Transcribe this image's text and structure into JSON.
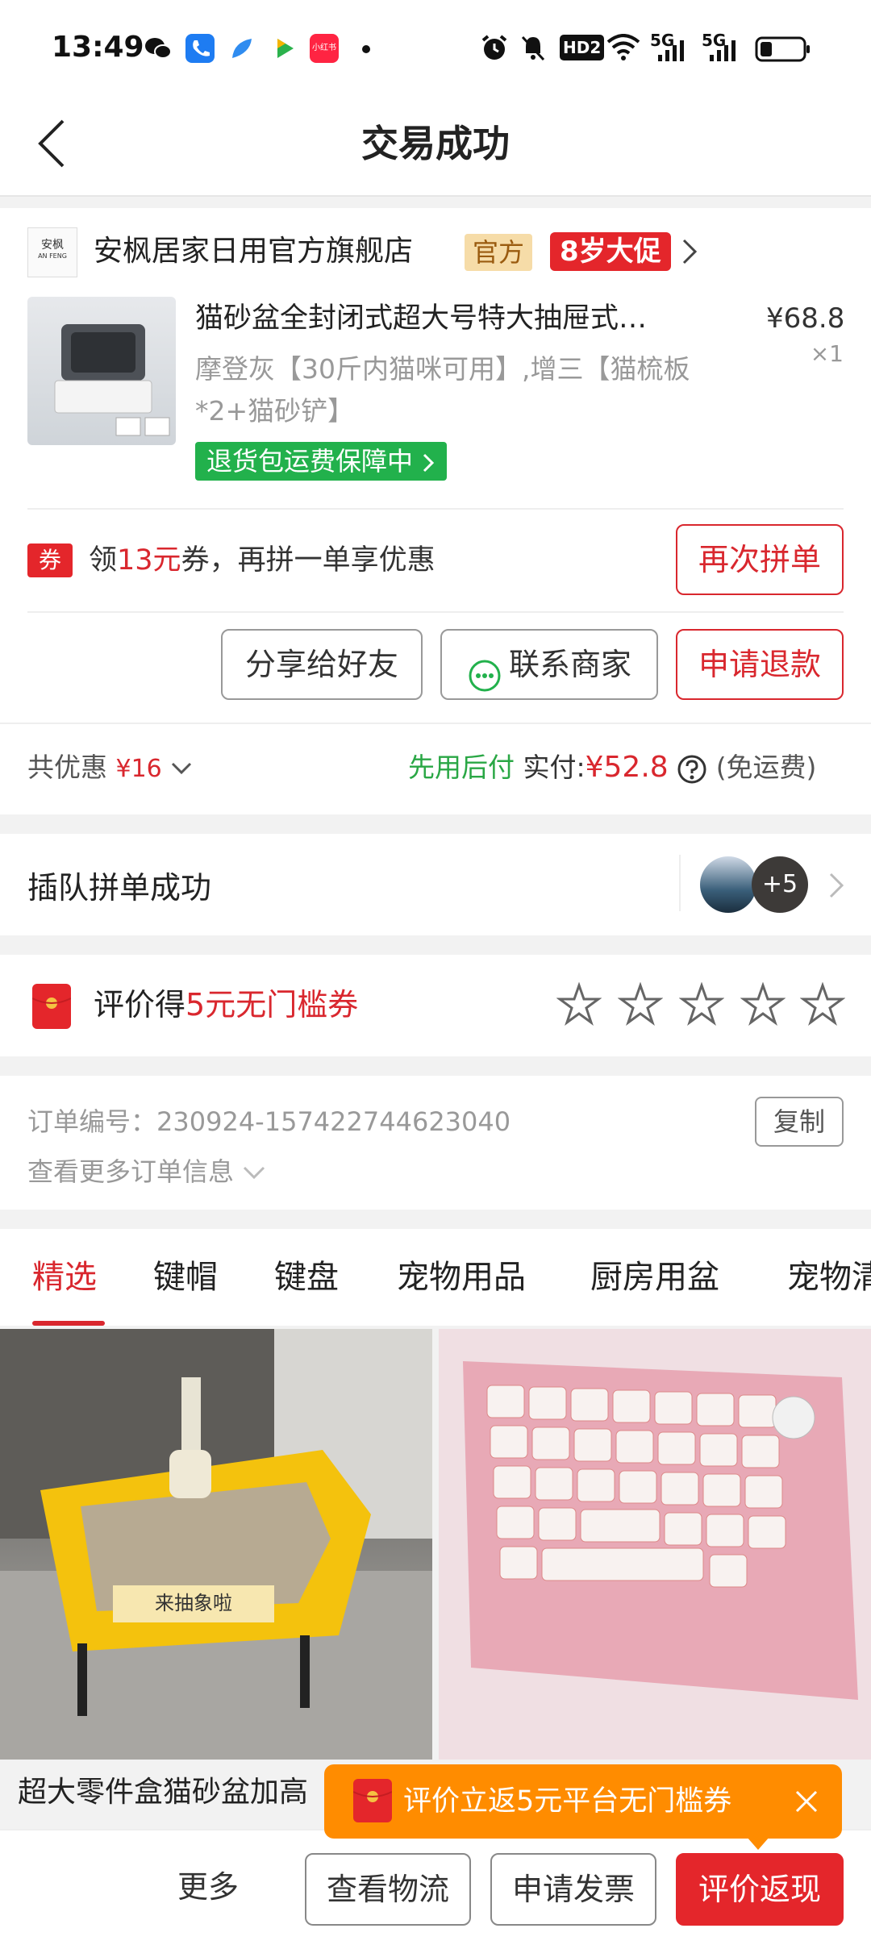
{
  "status_bar": {
    "time": "13:49",
    "app_icons": [
      "wechat-icon",
      "phone-icon",
      "feather-icon",
      "video-icon",
      "xiaohongshu-icon"
    ],
    "xhs_label": "小红书",
    "hd_label": "HD2",
    "net1": "5G",
    "net2": "5G"
  },
  "nav": {
    "title": "交易成功"
  },
  "shop": {
    "logo_text": "安枫",
    "logo_sub": "AN FENG",
    "name": "安枫居家日用官方旗舰店",
    "badge_official": "官方",
    "badge_promo": "8岁大促"
  },
  "product": {
    "title": "猫砂盆全封闭式超大号特大抽屉式…",
    "price": "¥68.8",
    "qty": "×1",
    "spec": "摩登灰【30斤内猫咪可用】,增三【猫梳板*2+猫砂铲】",
    "guarantee": "退货包运费保障中"
  },
  "coupon": {
    "icon": "券",
    "text_prefix": "领",
    "amount": "13元",
    "text_suffix": "券，再拼一单享优惠",
    "rebuy_button": "再次拼单"
  },
  "actions": {
    "share": "分享给好友",
    "contact": "联系商家",
    "refund": "申请退款"
  },
  "summary": {
    "discount_label": "共优惠",
    "discount_value": "¥16",
    "pay_later": "先用后付",
    "paid_label": "实付:",
    "paid_value": "¥52.8",
    "shipping": "(免运费)"
  },
  "group": {
    "label": "插队拼单成功",
    "extra_count": "+5"
  },
  "review": {
    "prefix": "评价得",
    "reward": "5元无门槛券",
    "stars": 0
  },
  "order": {
    "number_label": "订单编号：",
    "number": "230924-157422744623040",
    "more": "查看更多订单信息",
    "copy": "复制"
  },
  "tabs": [
    "精选",
    "键帽",
    "键盘",
    "宠物用品",
    "厨房用盆",
    "宠物清"
  ],
  "feed": {
    "item1_title": "超大零件盒猫砂盆加高",
    "item1_label": "来抽象啦"
  },
  "promo_popup": {
    "text": "评价立返5元平台无门槛券"
  },
  "bottom": {
    "more": "更多",
    "logistics": "查看物流",
    "invoice": "申请发票",
    "review_cashback": "评价返现"
  },
  "colors": {
    "accent_red": "#d9272e",
    "green": "#22b14c",
    "orange": "#ff8c00"
  }
}
